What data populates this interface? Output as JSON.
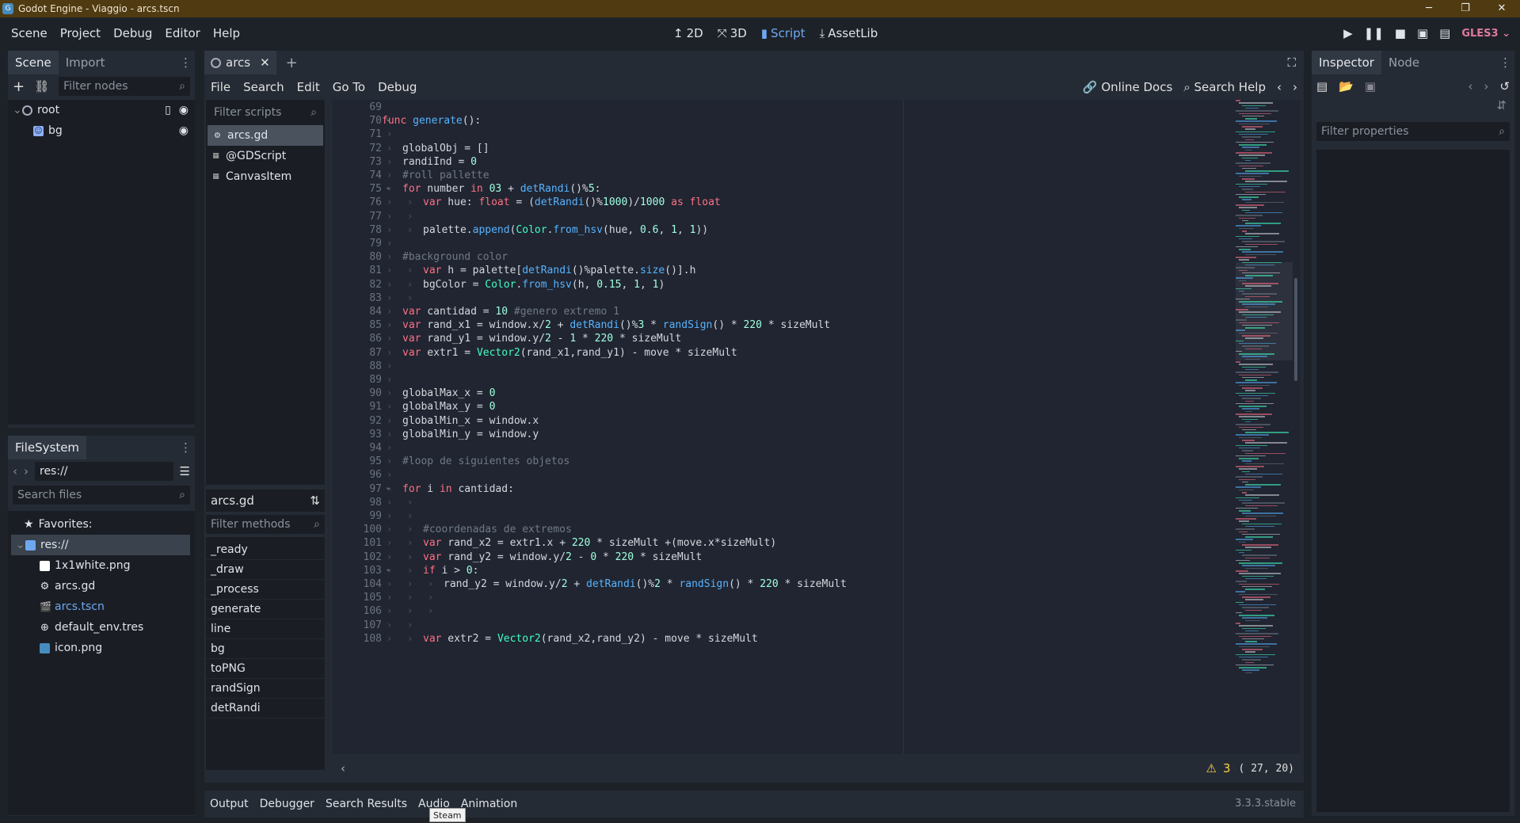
{
  "window": {
    "title": "Godot Engine - Viaggio - arcs.tscn",
    "buttons": [
      "─",
      "❐",
      "✕"
    ]
  },
  "menu": [
    "Scene",
    "Project",
    "Debug",
    "Editor",
    "Help"
  ],
  "workspaces": {
    "d2": "2D",
    "d3": "3D",
    "script": "Script",
    "assetlib": "AssetLib"
  },
  "renderer": "GLES3",
  "scene_dock": {
    "tabs": [
      "Scene",
      "Import"
    ],
    "filter_placeholder": "Filter nodes",
    "nodes": [
      {
        "name": "root"
      },
      {
        "name": "bg"
      }
    ]
  },
  "filesystem": {
    "title": "FileSystem",
    "path": "res://",
    "search_placeholder": "Search files",
    "favorites": "Favorites:",
    "root": "res://",
    "files": [
      {
        "name": "1x1white.png",
        "icon": "image-white-icon"
      },
      {
        "name": "arcs.gd",
        "icon": "gear-icon"
      },
      {
        "name": "arcs.tscn",
        "icon": "scene-icon",
        "color": "#6fa8f0"
      },
      {
        "name": "default_env.tres",
        "icon": "globe-icon"
      },
      {
        "name": "icon.png",
        "icon": "image-icon"
      }
    ]
  },
  "editor_tab": {
    "label": "arcs"
  },
  "script_menu": [
    "File",
    "Search",
    "Edit",
    "Go To",
    "Debug"
  ],
  "script_right": {
    "docs": "Online Docs",
    "help": "Search Help"
  },
  "scripts_panel": {
    "filter_placeholder": "Filter scripts",
    "items": [
      "arcs.gd",
      "@GDScript",
      "CanvasItem"
    ],
    "current": "arcs.gd",
    "methods_placeholder": "Filter methods",
    "methods": [
      "_ready",
      "_draw",
      "_process",
      "generate",
      "line",
      "bg",
      "toPNG",
      "randSign",
      "detRandi"
    ]
  },
  "code_lines": [
    {
      "n": "69",
      "t": ""
    },
    {
      "n": "70",
      "t": "<span class='kw'>func</span> <span class='fn'>generate</span>():",
      "fold": true
    },
    {
      "n": "71",
      "t": "\t"
    },
    {
      "n": "72",
      "t": "\tglobalObj = []"
    },
    {
      "n": "73",
      "t": "\trandiInd = <span class='num'>0</span>"
    },
    {
      "n": "74",
      "t": "\t<span class='cm'>#roll pallette</span>"
    },
    {
      "n": "75",
      "t": "\t<span class='kw'>for</span> number <span class='kw'>in</span> <span class='num'>03</span> + <span class='fn'>detRandi</span>()%<span class='num'>5</span>:",
      "fold": true
    },
    {
      "n": "76",
      "t": "\t\t<span class='kw'>var</span> hue: <span class='kw'>float</span> = (<span class='fn'>detRandi</span>()%<span class='num'>1000</span>)/<span class='num'>1000</span> <span class='kw'>as</span> <span class='kw'>float</span>"
    },
    {
      "n": "77",
      "t": "\t\t"
    },
    {
      "n": "78",
      "t": "\t\tpalette.<span class='fn'>append</span>(<span class='ty'>Color</span>.<span class='fn'>from_hsv</span>(hue, <span class='num'>0.6</span>, <span class='num'>1</span>, <span class='num'>1</span>))"
    },
    {
      "n": "79",
      "t": "\t"
    },
    {
      "n": "80",
      "t": "\t<span class='cm'>#background color</span>"
    },
    {
      "n": "81",
      "t": "\t\t<span class='kw'>var</span> h = palette[<span class='fn'>detRandi</span>()%palette.<span class='fn'>size</span>()].h"
    },
    {
      "n": "82",
      "t": "\t\tbgColor = <span class='ty'>Color</span>.<span class='fn'>from_hsv</span>(h, <span class='num'>0.15</span>, <span class='num'>1</span>, <span class='num'>1</span>)"
    },
    {
      "n": "83",
      "t": "\t\t"
    },
    {
      "n": "84",
      "t": "\t<span class='kw'>var</span> cantidad = <span class='num'>10</span> <span class='cm'>#genero extremo 1</span>"
    },
    {
      "n": "85",
      "t": "\t<span class='kw'>var</span> rand_x1 = window.x/<span class='num'>2</span> + <span class='fn'>detRandi</span>()%<span class='num'>3</span> * <span class='fn'>randSign</span>() * <span class='num'>220</span> * sizeMult"
    },
    {
      "n": "86",
      "t": "\t<span class='kw'>var</span> rand_y1 = window.y/<span class='num'>2</span> - <span class='num'>1</span> * <span class='num'>220</span> * sizeMult"
    },
    {
      "n": "87",
      "t": "\t<span class='kw'>var</span> extr1 = <span class='ty'>Vector2</span>(rand_x1,rand_y1) - move * sizeMult"
    },
    {
      "n": "88",
      "t": "\t"
    },
    {
      "n": "89",
      "t": "\t"
    },
    {
      "n": "90",
      "t": "\tglobalMax_x = <span class='num'>0</span>"
    },
    {
      "n": "91",
      "t": "\tglobalMax_y = <span class='num'>0</span>"
    },
    {
      "n": "92",
      "t": "\tglobalMin_x = window.x"
    },
    {
      "n": "93",
      "t": "\tglobalMin_y = window.y"
    },
    {
      "n": "94",
      "t": "\t"
    },
    {
      "n": "95",
      "t": "\t<span class='cm'>#loop de siguientes objetos</span>"
    },
    {
      "n": "96",
      "t": "\t"
    },
    {
      "n": "97",
      "t": "\t<span class='kw'>for</span> i <span class='kw'>in</span> cantidad:",
      "fold": true
    },
    {
      "n": "98",
      "t": "\t\t"
    },
    {
      "n": "99",
      "t": "\t\t"
    },
    {
      "n": "100",
      "t": "\t\t<span class='cm'>#coordenadas de extremos</span>"
    },
    {
      "n": "101",
      "t": "\t\t<span class='kw'>var</span> rand_x2 = extr1.x + <span class='num'>220</span> * sizeMult +(move.x*sizeMult)"
    },
    {
      "n": "102",
      "t": "\t\t<span class='kw'>var</span> rand_y2 = window.y/<span class='num'>2</span> - <span class='num'>0</span> * <span class='num'>220</span> * sizeMult"
    },
    {
      "n": "103",
      "t": "\t\t<span class='kw'>if</span> i &gt; <span class='num'>0</span>:",
      "fold": true
    },
    {
      "n": "104",
      "t": "\t\t\trand_y2 = window.y/<span class='num'>2</span> + <span class='fn'>detRandi</span>()%<span class='num'>2</span> * <span class='fn'>randSign</span>() * <span class='num'>220</span> * sizeMult"
    },
    {
      "n": "105",
      "t": "\t\t\t"
    },
    {
      "n": "106",
      "t": "\t\t\t"
    },
    {
      "n": "107",
      "t": "\t\t"
    },
    {
      "n": "108",
      "t": "\t\t<span class='kw'>var</span> extr2 = <span class='ty'>Vector2</span>(rand_x2,rand_y2) - move * sizeMult"
    }
  ],
  "status": {
    "warnings": "3",
    "position": "(  27, 20)"
  },
  "bottom_tabs": [
    "Output",
    "Debugger",
    "Search Results",
    "Audio",
    "Animation"
  ],
  "tooltip": "Steam",
  "version": "3.3.3.stable",
  "inspector": {
    "tabs": [
      "Inspector",
      "Node"
    ],
    "filter_placeholder": "Filter properties"
  },
  "colors": {
    "accent": "#6fa8f0",
    "menubar": "#1d2229",
    "panel": "#252b34",
    "titlebar": "#4f3a12"
  }
}
